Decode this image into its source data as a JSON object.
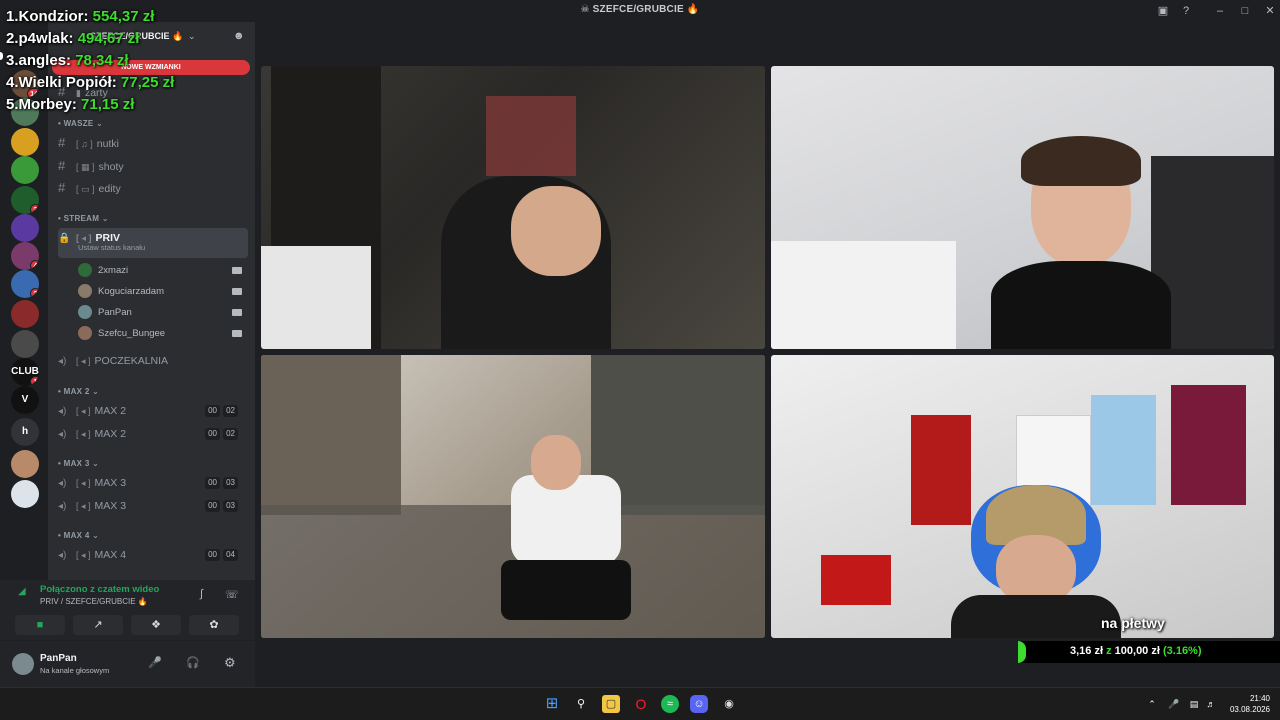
{
  "window": {
    "title": "☠ SZEFCE/GRUBCIE 🔥"
  },
  "leaderboard": [
    {
      "rank": "1.",
      "name": "Kondzior:",
      "amount": "554,37 zł"
    },
    {
      "rank": "2.",
      "name": "p4wlak:",
      "amount": "494,67 zł"
    },
    {
      "rank": "3.",
      "name": "angles:",
      "amount": "78,34 zł"
    },
    {
      "rank": "4.",
      "name": "Wielki Popiół:",
      "amount": "77,25 zł"
    },
    {
      "rank": "5.",
      "name": "Morbey:",
      "amount": "71,15 zł"
    }
  ],
  "server": {
    "name": "SZEFCE/GRUBCIE 🔥",
    "mentions_label": "NOWE WZMIANKI"
  },
  "servers": [
    {
      "label": "",
      "badge": "14",
      "color": "#6b4e3a"
    },
    {
      "label": "",
      "badge": "",
      "color": "#4f7a5a"
    },
    {
      "label": "",
      "badge": "",
      "color": "#d8a020"
    },
    {
      "label": "",
      "badge": "",
      "color": "#3a9a3a"
    },
    {
      "label": "",
      "badge": "3",
      "color": "#1f5e2c"
    },
    {
      "label": "",
      "badge": "",
      "color": "#5a3aa0"
    },
    {
      "label": "",
      "badge": "4",
      "color": "#7a3a6a"
    },
    {
      "label": "",
      "badge": "2",
      "color": "#3a6ab0"
    },
    {
      "label": "",
      "badge": "",
      "color": "#8a2a2a"
    },
    {
      "label": "",
      "badge": "",
      "color": "#4a4a4a"
    },
    {
      "label": "CLUB",
      "badge": "1",
      "color": "#111111"
    },
    {
      "label": "V",
      "badge": "",
      "color": "#111111"
    },
    {
      "label": "h",
      "badge": "",
      "color": "#313338"
    },
    {
      "label": "",
      "badge": "",
      "color": "#b88a6a"
    },
    {
      "label": "",
      "badge": "",
      "color": "#dde3ea"
    }
  ],
  "channels": {
    "top": [
      {
        "name": "żarty"
      }
    ],
    "categories": [
      {
        "label": "WASZE",
        "text_channels": [
          "nutki",
          "shoty",
          "edity"
        ]
      },
      {
        "label": "STREAM"
      },
      {
        "label": "MAX 2"
      },
      {
        "label": "MAX 3"
      },
      {
        "label": "MAX 4"
      }
    ],
    "priv": {
      "name": "PRIV",
      "status": "Ustaw status kanału"
    },
    "members": [
      "2xmazi",
      "Koguciarzadam",
      "PanPan",
      "Szefcu_Bungee"
    ],
    "waiting": "POCZEKALNIA",
    "max2": [
      {
        "name": "MAX 2",
        "a": "00",
        "b": "02"
      },
      {
        "name": "MAX 2",
        "a": "00",
        "b": "02"
      }
    ],
    "max3": [
      {
        "name": "MAX 3",
        "a": "00",
        "b": "03"
      },
      {
        "name": "MAX 3",
        "a": "00",
        "b": "03"
      }
    ],
    "max4": [
      {
        "name": "MAX 4",
        "a": "00",
        "b": "04"
      }
    ]
  },
  "voice": {
    "status": "Połączono z czatem wideo",
    "location": "PRIV / SZEFCE/GRUBCIE 🔥"
  },
  "user": {
    "name": "PanPan",
    "status": "Na kanale głosowym"
  },
  "video": {
    "caption": "na płetwy"
  },
  "goal": {
    "current": "3,16 zł",
    "word": "z",
    "target": "100,00 zł",
    "percent_label": "(3.16%)",
    "progress": 0.0316
  },
  "taskbar": {
    "time": "21:40",
    "date": "03.08.2026"
  },
  "colors": {
    "accent_green": "#3ddc2f",
    "mention_red": "#da373c",
    "sidebar": "#2b2d31"
  }
}
